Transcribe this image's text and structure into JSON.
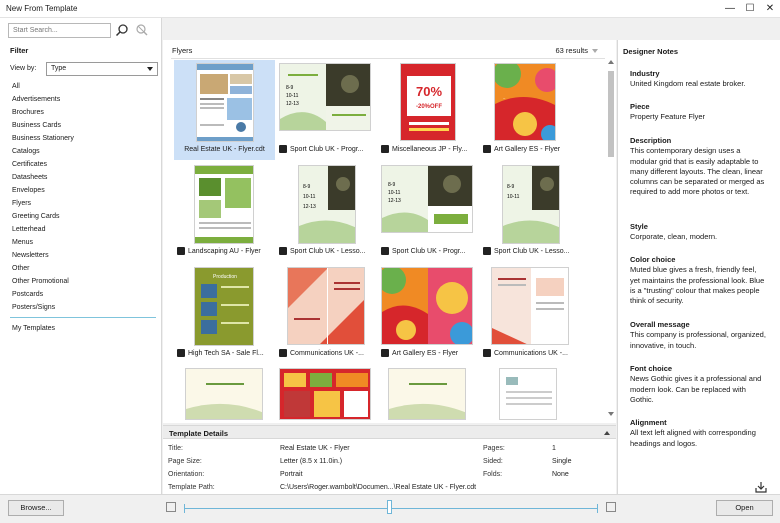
{
  "window": {
    "title": "New From Template",
    "minimize": "—",
    "maximize": "☐",
    "close": "✕"
  },
  "search": {
    "placeholder": "Start Search..."
  },
  "filter": {
    "heading": "Filter",
    "view_by_label": "View by:",
    "view_by_value": "Type",
    "categories": [
      "All",
      "Advertisements",
      "Brochures",
      "Business Cards",
      "Business Stationery",
      "Catalogs",
      "Certificates",
      "Datasheets",
      "Envelopes",
      "Flyers",
      "Greeting Cards",
      "Letterhead",
      "Menus",
      "Newsletters",
      "Other",
      "Other Promotional",
      "Postcards",
      "Posters/Signs"
    ],
    "my_templates": "My Templates"
  },
  "gallery": {
    "heading": "Flyers",
    "results": "63 results",
    "items": [
      {
        "caption": "Real Estate UK - Flyer.cdt",
        "selected": true
      },
      {
        "caption": "Sport Club UK - Progr..."
      },
      {
        "caption": "Miscellaneous JP - Fly..."
      },
      {
        "caption": "Art Gallery ES - Flyer"
      },
      {
        "caption": "Landscaping AU - Flyer"
      },
      {
        "caption": "Sport Club UK - Lesso..."
      },
      {
        "caption": "Sport Club UK - Progr..."
      },
      {
        "caption": "Sport Club UK - Lesso..."
      },
      {
        "caption": "High Tech SA - Sale Fl..."
      },
      {
        "caption": "Communications UK -..."
      },
      {
        "caption": "Art Gallery ES - Flyer"
      },
      {
        "caption": "Communications UK -..."
      }
    ]
  },
  "thumb_text": {
    "misc_percent": "70%",
    "misc_off": "-20%OFF",
    "high_tech": "Production"
  },
  "details": {
    "heading": "Template Details",
    "title_label": "Title:",
    "title_value": "Real Estate UK - Flyer",
    "page_size_label": "Page Size:",
    "page_size_value": "Letter (8.5 x 11.0in.)",
    "orientation_label": "Orientation:",
    "orientation_value": "Portrait",
    "path_label": "Template Path:",
    "path_value": "C:\\Users\\Roger.wambolt\\Documen...\\Real Estate UK - Flyer.cdt",
    "pages_label": "Pages:",
    "pages_value": "1",
    "sided_label": "Sided:",
    "sided_value": "Single",
    "folds_label": "Folds:",
    "folds_value": "None"
  },
  "notes": {
    "heading": "Designer Notes",
    "industry_h": "Industry",
    "industry": "United Kingdom real estate broker.",
    "piece_h": "Piece",
    "piece": "Property Feature Flyer",
    "description_h": "Description",
    "description": "This contemporary design uses a modular grid that is easily adaptable to many different layouts. The clean, linear columns can be separated or merged as required to add more photos or text.",
    "style_h": "Style",
    "style": "Corporate, clean, modern.",
    "color_h": "Color choice",
    "color": "Muted blue gives a fresh, friendly feel, yet maintains the professional look. Blue is a \"trusting\" colour that makes people think of security.",
    "message_h": "Overall message",
    "message": "This company is professional, organized, innovative, in touch.",
    "font_h": "Font choice",
    "font": "News Gothic gives it a professional and modern look. Can be replaced with Gothic.",
    "align_h": "Alignment",
    "align": "All text left aligned with corresponding headings and logos."
  },
  "footer": {
    "browse": "Browse...",
    "open": "Open"
  },
  "colors": {
    "accent": "#6fb6d8",
    "selection": "#cce0f7",
    "green": "#7cae3e",
    "orange": "#f08a24",
    "red": "#d6262b"
  }
}
